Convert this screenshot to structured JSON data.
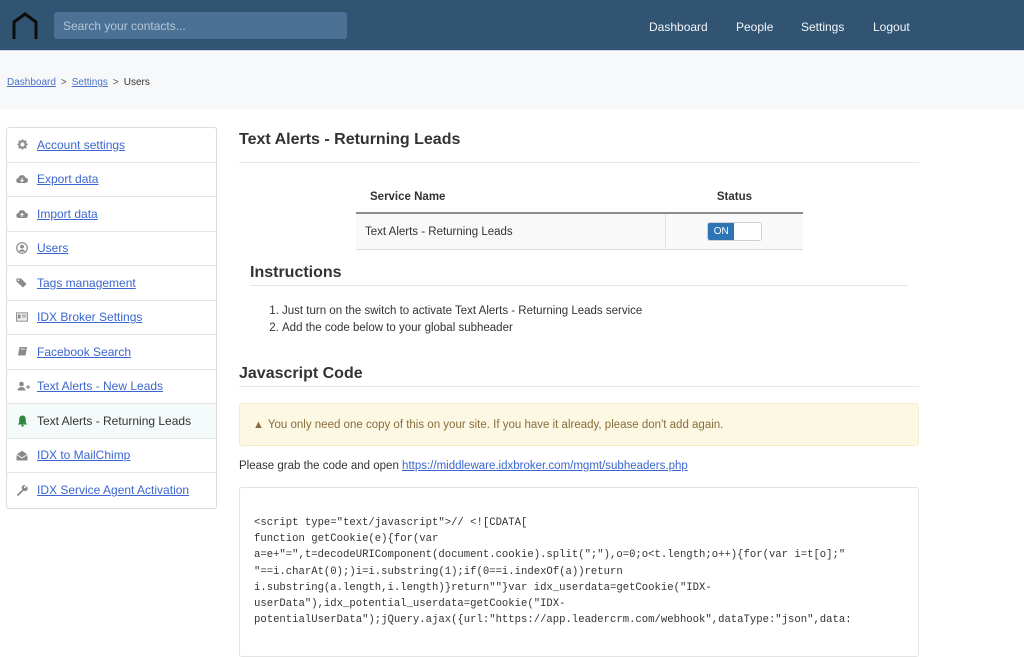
{
  "header": {
    "logo_icon": "house-outline-icon",
    "search_placeholder": "Search your contacts...",
    "nav": [
      "Dashboard",
      "People",
      "Settings",
      "Logout"
    ]
  },
  "breadcrumb": {
    "items": [
      "Dashboard",
      "Settings"
    ],
    "current": "Users",
    "separator": ">"
  },
  "sidebar": {
    "items": [
      {
        "label": "Account settings",
        "icon": "gear-icon",
        "active": false
      },
      {
        "label": "Export data",
        "icon": "cloud-download-icon",
        "active": false
      },
      {
        "label": "Import data",
        "icon": "cloud-upload-icon",
        "active": false
      },
      {
        "label": "Users",
        "icon": "user-circle-icon",
        "active": false
      },
      {
        "label": "Tags management",
        "icon": "tags-icon",
        "active": false
      },
      {
        "label": "IDX Broker Settings",
        "icon": "id-card-icon",
        "active": false
      },
      {
        "label": "Facebook Search",
        "icon": "book-icon",
        "active": false
      },
      {
        "label": "Text Alerts - New Leads",
        "icon": "user-plus-icon",
        "active": false
      },
      {
        "label": "Text Alerts - Returning Leads",
        "icon": "bell-icon",
        "active": true
      },
      {
        "label": "IDX to MailChimp",
        "icon": "envelope-open-icon",
        "active": false
      },
      {
        "label": "IDX Service Agent Activation",
        "icon": "wrench-icon",
        "active": false
      }
    ]
  },
  "main": {
    "title": "Text Alerts - Returning Leads",
    "table": {
      "headers": [
        "Service Name",
        "Status"
      ],
      "rows": [
        {
          "service": "Text Alerts - Returning Leads",
          "status": "ON"
        }
      ]
    },
    "instructions_title": "Instructions",
    "instructions": [
      "Just turn on the switch to activate Text Alerts - Returning Leads service",
      "Add the code below to your global subheader"
    ],
    "code_title": "Javascript Code",
    "alert": "You only need one copy of this on your site. If you have it already, please don't add again.",
    "grab_text": "Please grab the code and open ",
    "grab_link": "https://middleware.idxbroker.com/mgmt/subheaders.php",
    "code": "<script type=\"text/javascript\">// <![CDATA[\nfunction getCookie(e){for(var\na=e+\"=\",t=decodeURIComponent(document.cookie).split(\";\"),o=0;o<t.length;o++){for(var i=t[o];\"\n\"==i.charAt(0);)i=i.substring(1);if(0==i.indexOf(a))return\ni.substring(a.length,i.length)}return\"\"}var idx_userdata=getCookie(\"IDX-\nuserData\"),idx_potential_userdata=getCookie(\"IDX-\npotentialUserData\");jQuery.ajax({url:\"https://app.leadercrm.com/webhook\",dataType:\"json\",data:"
  },
  "colors": {
    "header_bg": "#315473",
    "link": "#3b66cf",
    "switch_on": "#2f74b5",
    "alert_bg": "#fcf8e3",
    "bell_active": "#2e8b3d"
  }
}
